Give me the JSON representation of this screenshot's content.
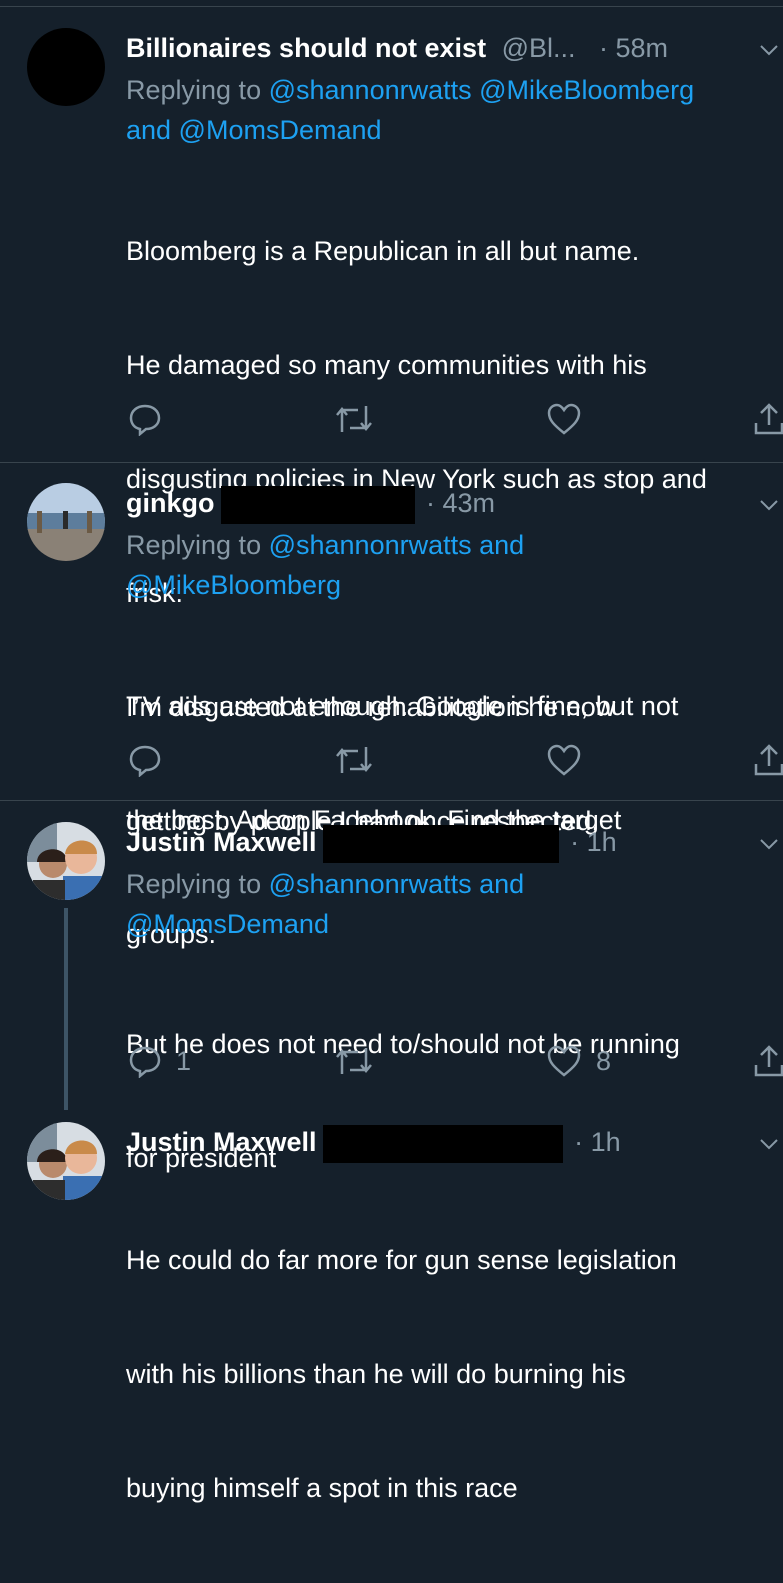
{
  "tweets": [
    {
      "name": "Billionaires should not exist",
      "handle": "@Bl...",
      "time": "· 58m",
      "replying_prefix": "Replying to ",
      "replying_line1": "@shannonrwatts @MikeBloomberg",
      "replying_line2": "and @MomsDemand",
      "replying_line2_link": "@MomsDemand",
      "replying_and": "and ",
      "body": [
        "Bloomberg is a Republican in all but name.",
        "He damaged so many communities with his",
        "disgusting policies in New York such as stop and",
        "frisk.",
        "I’m disgusted at the rehabilitation he now",
        "getting by people I had once respected."
      ],
      "reply_count": "",
      "like_count": ""
    },
    {
      "name": "ginkgo",
      "time": "· 43m",
      "replying_prefix": "Replying to ",
      "replying_line1_link": "@shannonrwatts",
      "replying_line1_and": " and",
      "replying_line2": "@MikeBloomberg",
      "body": [
        "TV ads are not enough. Google is fine, but not",
        "the best. Ad on Facebook. Find the target",
        "groups."
      ],
      "reply_count": "",
      "like_count": ""
    },
    {
      "name": "Justin Maxwell",
      "time": "· 1h",
      "replying_prefix": "Replying to ",
      "replying_line1_link": "@shannonrwatts",
      "replying_line1_and": " and",
      "replying_line2": "@MomsDemand",
      "body": [
        "But he does not need to/should not be running",
        "for president"
      ],
      "reply_count": "1",
      "like_count": "8"
    },
    {
      "name": "Justin Maxwell",
      "time": "· 1h",
      "body": [
        "He could do far more for gun sense legislation",
        "with his billions than he will do burning his",
        "buying himself a spot in this race"
      ]
    }
  ],
  "colors": {
    "background": "#15202b",
    "divider": "#38444d",
    "secondary_text": "#8899a6",
    "link": "#1da1f2"
  },
  "icons": [
    "reply-icon",
    "retweet-icon",
    "like-icon",
    "share-icon",
    "chevron-down-icon"
  ]
}
